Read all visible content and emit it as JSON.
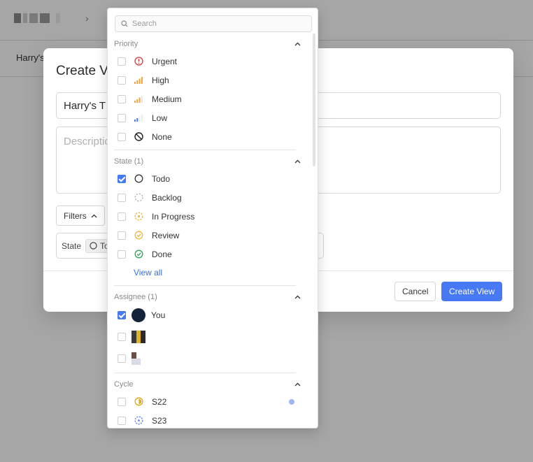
{
  "background": {
    "subtitle": "Harry's"
  },
  "modal": {
    "title": "Create V",
    "name_value": "Harry's T",
    "description_placeholder": "Descriptio",
    "filters_label": "Filters",
    "state_label": "State",
    "state_chip": "To",
    "cancel_label": "Cancel",
    "create_label": "Create View"
  },
  "dropdown": {
    "search_placeholder": "Search",
    "priority": {
      "header": "Priority",
      "items": [
        {
          "label": "Urgent",
          "icon": "urgent-icon",
          "checked": false
        },
        {
          "label": "High",
          "icon": "signal-high-icon",
          "checked": false
        },
        {
          "label": "Medium",
          "icon": "signal-medium-icon",
          "checked": false
        },
        {
          "label": "Low",
          "icon": "signal-low-icon",
          "checked": false
        },
        {
          "label": "None",
          "icon": "no-priority-icon",
          "checked": false
        }
      ]
    },
    "state": {
      "header": "State (1)",
      "items": [
        {
          "label": "Todo",
          "icon": "todo-circle-icon",
          "checked": true
        },
        {
          "label": "Backlog",
          "icon": "backlog-dashed-circle-icon",
          "checked": false
        },
        {
          "label": "In Progress",
          "icon": "in-progress-circle-icon",
          "checked": false
        },
        {
          "label": "Review",
          "icon": "review-check-icon",
          "checked": false
        },
        {
          "label": "Done",
          "icon": "done-check-icon",
          "checked": false
        }
      ],
      "view_all": "View all"
    },
    "assignee": {
      "header": "Assignee (1)",
      "items": [
        {
          "label": "You",
          "checked": true
        }
      ]
    },
    "cycle": {
      "header": "Cycle",
      "items": [
        {
          "label": "S22",
          "icon": "cycle-half-icon",
          "checked": false
        },
        {
          "label": "S23",
          "icon": "cycle-dashed-icon",
          "checked": false
        }
      ]
    }
  },
  "colors": {
    "accent": "#4879f5",
    "urgent": "#d93a3a",
    "signal": "#f2a33a",
    "low": "#4879f5",
    "in_progress": "#f0b73a",
    "done": "#2ea05a"
  }
}
